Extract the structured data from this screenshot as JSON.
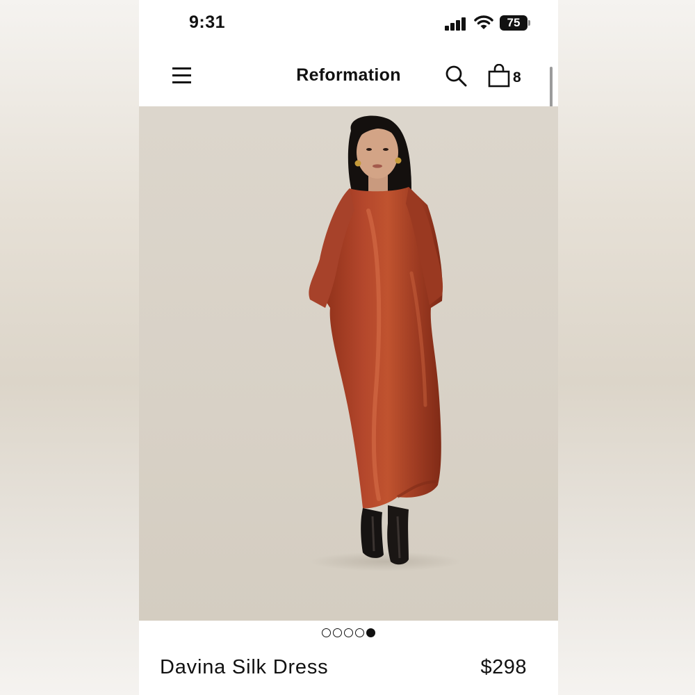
{
  "status_bar": {
    "time": "9:31",
    "battery": "75"
  },
  "header": {
    "brand": "Reformation",
    "bag_count": "8"
  },
  "product": {
    "name": "Davina Silk Dress",
    "price": "$298",
    "image_alt": "Model wearing rust silk long-sleeve maxi dress with black boots",
    "dress_color": "#a63d25"
  },
  "carousel": {
    "total": 5,
    "active_index": 5
  },
  "icons": [
    "menu-icon",
    "search-icon",
    "shopping-bag-icon",
    "signal-icon",
    "wifi-icon",
    "battery-icon"
  ]
}
